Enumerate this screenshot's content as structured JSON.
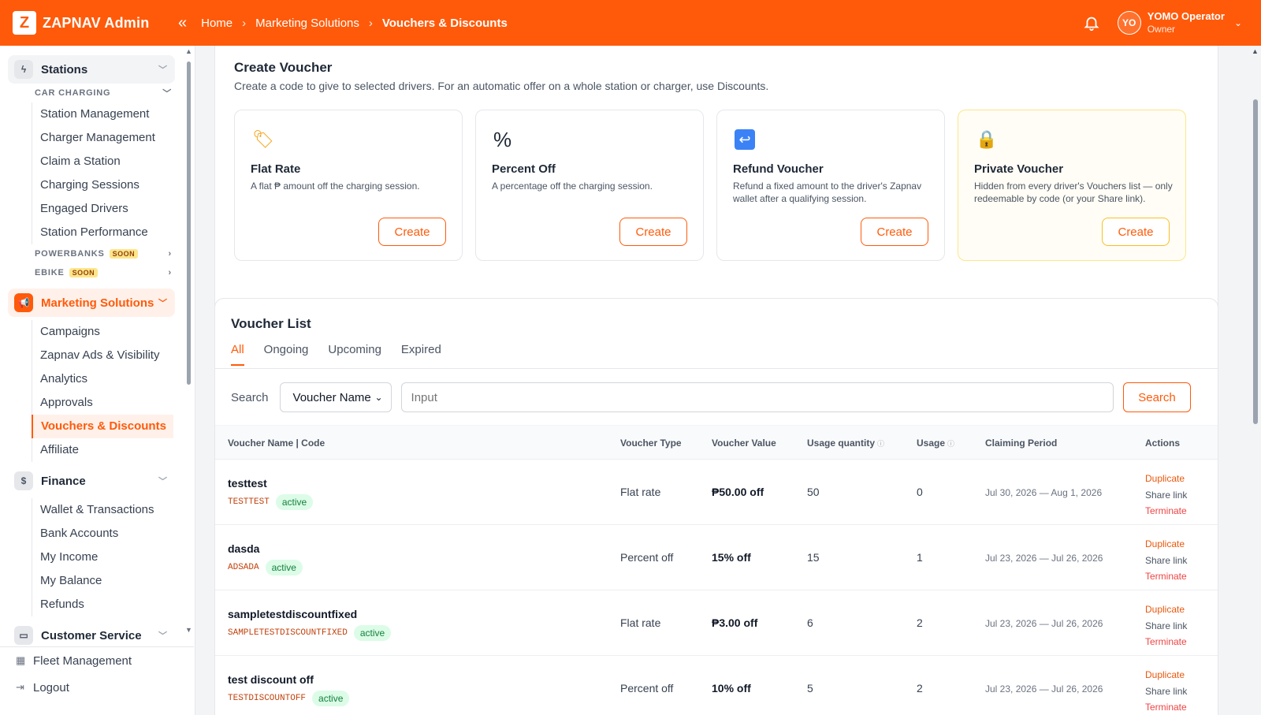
{
  "app": {
    "name": "ZAPNAV Admin",
    "logo_letter": "Z"
  },
  "breadcrumb": [
    "Home",
    "Marketing Solutions",
    "Vouchers & Discounts"
  ],
  "user": {
    "initials": "YO",
    "name": "YOMO Operator",
    "role": "Owner"
  },
  "colors": {
    "brand": "#ff5a0a",
    "active_badge": "#dcfce7",
    "terminate": "#ef4444"
  },
  "sidebar": {
    "stations": {
      "label": "Stations",
      "car_charging": "CAR CHARGING",
      "items": [
        "Station Management",
        "Charger Management",
        "Claim a Station",
        "Charging Sessions",
        "Engaged Drivers",
        "Station Performance"
      ],
      "powerbanks": "POWERBANKS",
      "ebike": "EBIKE",
      "soon": "SOON"
    },
    "marketing": {
      "label": "Marketing Solutions",
      "items": [
        "Campaigns",
        "Zapnav Ads & Visibility",
        "Analytics",
        "Approvals",
        "Vouchers & Discounts",
        "Affiliate"
      ]
    },
    "finance": {
      "label": "Finance",
      "items": [
        "Wallet & Transactions",
        "Bank Accounts",
        "My Income",
        "My Balance",
        "Refunds"
      ]
    },
    "customer_service": "Customer Service",
    "fleet": "Fleet Management",
    "logout": "Logout"
  },
  "create_voucher": {
    "title": "Create Voucher",
    "description": "Create a code to give to selected drivers. For an automatic offer on a whole station or charger, use Discounts.",
    "options": [
      {
        "icon": "price-tag-icon",
        "glyph": "🏷",
        "title": "Flat Rate",
        "desc": "A flat ₱ amount off the charging session.",
        "button": "Create"
      },
      {
        "icon": "percent-icon",
        "glyph": "%",
        "title": "Percent Off",
        "desc": "A percentage off the charging session.",
        "button": "Create"
      },
      {
        "icon": "refund-arrow-icon",
        "glyph": "↩",
        "title": "Refund Voucher",
        "desc": "Refund a fixed amount to the driver's Zapnav wallet after a qualifying session.",
        "button": "Create"
      },
      {
        "icon": "lock-icon",
        "glyph": "🔒",
        "title": "Private Voucher",
        "desc": "Hidden from every driver's Vouchers list — only redeemable by code (or your Share link).",
        "button": "Create"
      }
    ]
  },
  "voucher_list": {
    "title": "Voucher List",
    "tabs": [
      "All",
      "Ongoing",
      "Upcoming",
      "Expired"
    ],
    "active_tab": "All",
    "search": {
      "label": "Search",
      "field": "Voucher Name",
      "placeholder": "Input",
      "button": "Search"
    },
    "columns": [
      "Voucher Name | Code",
      "Voucher Type",
      "Voucher Value",
      "Usage quantity",
      "Usage",
      "Claiming Period",
      "Actions"
    ],
    "rows": [
      {
        "name": "testtest",
        "code": "TESTTEST",
        "status": "active",
        "type": "Flat rate",
        "value": "₱50.00 off",
        "quantity": "50",
        "usage": "0",
        "period": "Jul 30, 2026 — Aug 1, 2026"
      },
      {
        "name": "dasda",
        "code": "ADSADA",
        "status": "active",
        "type": "Percent off",
        "value": "15% off",
        "quantity": "15",
        "usage": "1",
        "period": "Jul 23, 2026 — Jul 26, 2026"
      },
      {
        "name": "sampletestdiscountfixed",
        "code": "SAMPLETESTDISCOUNTFIXED",
        "status": "active",
        "type": "Flat rate",
        "value": "₱3.00 off",
        "quantity": "6",
        "usage": "2",
        "period": "Jul 23, 2026 — Jul 26, 2026"
      },
      {
        "name": "test discount off",
        "code": "TESTDISCOUNTOFF",
        "status": "active",
        "type": "Percent off",
        "value": "10% off",
        "quantity": "5",
        "usage": "2",
        "period": "Jul 23, 2026 — Jul 26, 2026"
      }
    ],
    "actions": {
      "duplicate": "Duplicate",
      "share": "Share link",
      "terminate": "Terminate"
    }
  }
}
